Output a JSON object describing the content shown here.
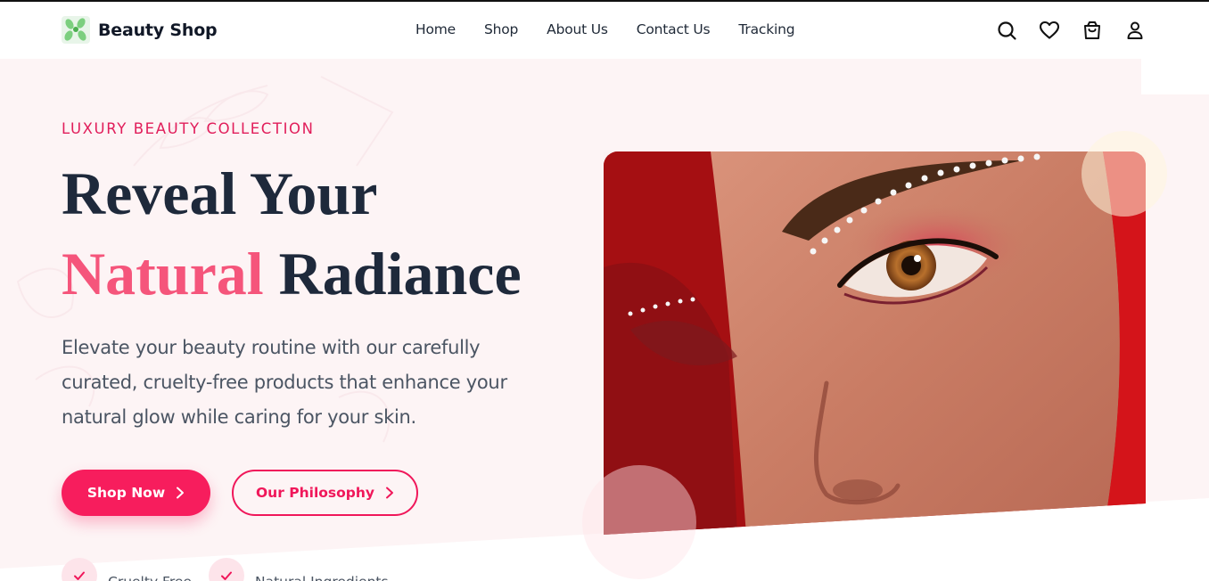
{
  "brand": {
    "name": "Beauty Shop"
  },
  "nav": {
    "items": [
      {
        "label": "Home"
      },
      {
        "label": "Shop"
      },
      {
        "label": "About Us"
      },
      {
        "label": "Contact Us"
      },
      {
        "label": "Tracking"
      }
    ]
  },
  "header_icons": [
    "search-icon",
    "heart-icon",
    "shopping-bag-icon",
    "user-icon"
  ],
  "hero": {
    "eyebrow": "LUXURY BEAUTY COLLECTION",
    "title_line1": "Reveal Your",
    "title_accent": "Natural",
    "title_line2_rest": " Radiance",
    "description": "Elevate your beauty routine with our carefully curated, cruelty-free products that enhance your natural glow while caring for your skin.",
    "primary_button": "Shop Now",
    "secondary_button": "Our Philosophy",
    "features": [
      {
        "label": "Cruelty Free"
      },
      {
        "label": "Natural Ingredients"
      }
    ]
  },
  "colors": {
    "accent": "#f71d5d",
    "accent_text": "#e11d5a",
    "title_accent": "#f5557b",
    "title_dark": "#1e293b",
    "hero_bg": "#fdf4f5"
  }
}
